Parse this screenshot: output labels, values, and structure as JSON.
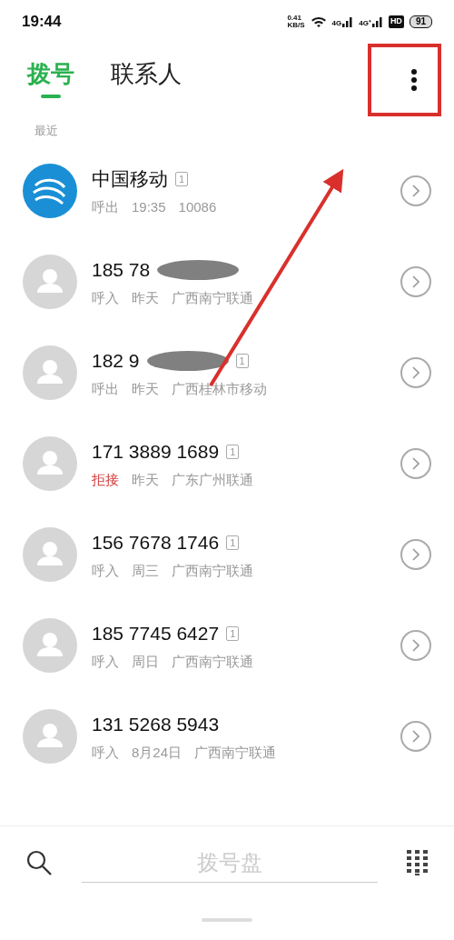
{
  "status_bar": {
    "time": "19:44",
    "speed": [
      "0.41",
      "KB/S"
    ],
    "networks": [
      "4G",
      "4G⁺"
    ],
    "hd": "HD",
    "battery": "91"
  },
  "tabs": [
    {
      "label": "拨号",
      "selected": true
    },
    {
      "label": "联系人",
      "selected": false
    }
  ],
  "section": "最近",
  "calls": [
    {
      "kind": "logo",
      "name": "中国移动",
      "sim": "1",
      "type": "呼出",
      "missed": false,
      "time": "19:35",
      "detail": "10086",
      "redacted": false
    },
    {
      "kind": "avatar",
      "name": "185 78",
      "type": "呼入",
      "missed": false,
      "time": "昨天",
      "detail": "广西南宁联通",
      "redacted": true
    },
    {
      "kind": "avatar",
      "name": "182 9",
      "sim": "1",
      "type": "呼出",
      "missed": false,
      "time": "昨天",
      "detail": "广西桂林市移动",
      "redacted": true
    },
    {
      "kind": "avatar",
      "name": "171 3889 1689",
      "sim": "1",
      "type": "拒接",
      "missed": true,
      "time": "昨天",
      "detail": "广东广州联通",
      "redacted": false
    },
    {
      "kind": "avatar",
      "name": "156 7678 1746",
      "sim": "1",
      "type": "呼入",
      "missed": false,
      "time": "周三",
      "detail": "广西南宁联通",
      "redacted": false
    },
    {
      "kind": "avatar",
      "name": "185 7745 6427",
      "sim": "1",
      "type": "呼入",
      "missed": false,
      "time": "周日",
      "detail": "广西南宁联通",
      "redacted": false
    },
    {
      "kind": "avatar",
      "name": "131 5268 5943",
      "type": "呼入",
      "missed": false,
      "time": "8月24日",
      "detail": "广西南宁联通",
      "redacted": false
    }
  ],
  "dial_bar": {
    "placeholder": "拨号盘"
  }
}
